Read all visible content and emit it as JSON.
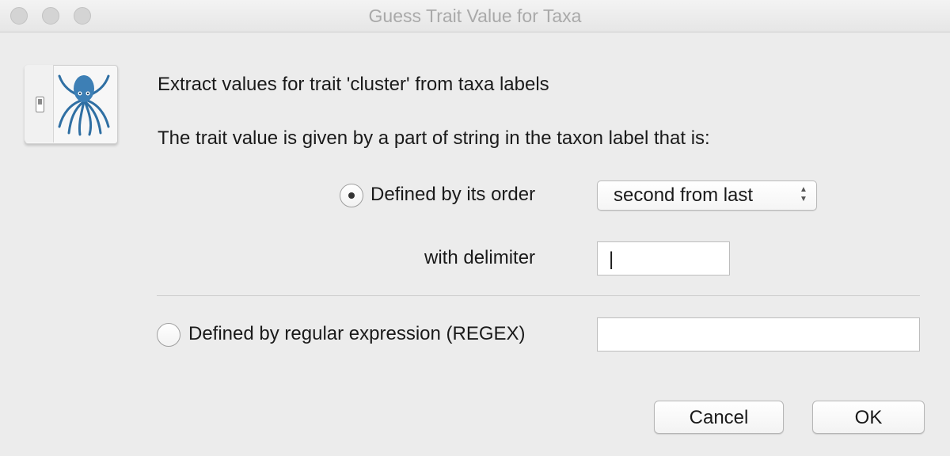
{
  "window": {
    "title": "Guess Trait Value for Taxa"
  },
  "dialog": {
    "heading": "Extract values for trait 'cluster' from taxa labels",
    "subheading": "The trait value is given by a part of string in the taxon label that is:",
    "option_order": {
      "label": "Defined by its order",
      "selected": true
    },
    "order_select": {
      "value": "second from last"
    },
    "delimiter": {
      "label": "with delimiter",
      "value": "|"
    },
    "option_regex": {
      "label": "Defined by regular expression (REGEX)",
      "selected": false,
      "value": ""
    }
  },
  "buttons": {
    "cancel": "Cancel",
    "ok": "OK"
  },
  "colors": {
    "background": "#ececec",
    "title_text": "#a9a9a9",
    "icon_blue": "#2f6fa3"
  },
  "icons": {
    "app": "octopus-icon",
    "switch": "toggle-switch-icon",
    "select": "up-down-chevron-icon"
  }
}
